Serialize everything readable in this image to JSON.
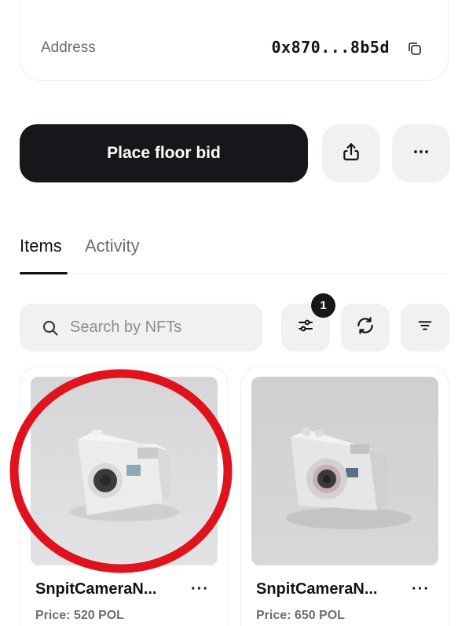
{
  "address": {
    "label": "Address",
    "value": "0x870...8b5d"
  },
  "actions": {
    "primary_label": "Place floor bid",
    "more_label": "···"
  },
  "tabs": [
    {
      "label": "Items",
      "active": true
    },
    {
      "label": "Activity",
      "active": false
    }
  ],
  "search": {
    "placeholder": "Search by NFTs",
    "value": ""
  },
  "filter_badge_count": "1",
  "nfts": [
    {
      "name": "SnpitCameraN...",
      "price": "Price: 520 POL",
      "more": "···"
    },
    {
      "name": "SnpitCameraN...",
      "price": "Price: 650 POL",
      "more": "···"
    }
  ],
  "colors": {
    "primary": "#16171a",
    "muted_text": "#6b6e73",
    "chip_bg": "#f1f1f2",
    "highlight_ring": "#e0121b"
  },
  "icons": [
    "copy-icon",
    "share-icon",
    "more-icon",
    "search-icon",
    "sliders-icon",
    "refresh-icon",
    "sort-icon"
  ]
}
